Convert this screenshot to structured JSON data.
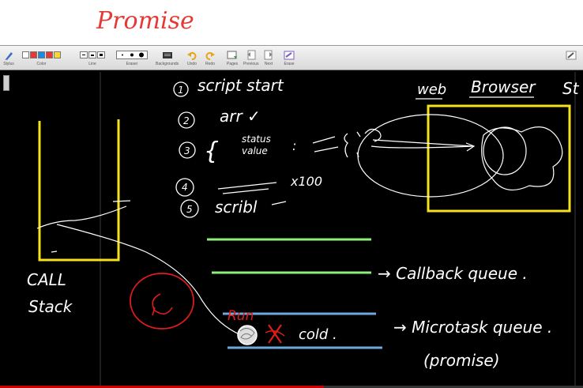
{
  "title": {
    "text": "Promise"
  },
  "toolbar": {
    "stylus": "Stylus",
    "color": "Color",
    "line": "Line",
    "eraser": "Eraser",
    "backgrounds": "Backgrounds",
    "undo": "Undo",
    "redo": "Redo",
    "pages": "Pages",
    "previous": "Previous",
    "next": "Next",
    "erase": "Erase",
    "swatches": [
      "#ffffff",
      "#e53935",
      "#1e88e5",
      "#e53935",
      "#fdd835"
    ]
  },
  "board": {
    "background": "#000000",
    "steps": [
      {
        "num": "1",
        "text": "script start"
      },
      {
        "num": "2",
        "text": "arr ✓"
      },
      {
        "num": "3",
        "text": "status",
        "text2": "value"
      },
      {
        "num": "4",
        "text": "x100"
      },
      {
        "num": "5",
        "text": "scribl"
      }
    ],
    "web_label": "web",
    "browser_label": "Browser",
    "st_label": "St",
    "call_label": "CALL",
    "stack_label": "Stack",
    "callback_label": "→ Callback queue .",
    "microtask_label": "→ Microtask queue .",
    "promise_label": "(promise)",
    "run_label": "Run",
    "cold_label": "cold .",
    "colors": {
      "yellow": "#f5e21b",
      "green": "#8cf07a",
      "blue": "#6fa8dc",
      "red": "#e21b1b",
      "white": "#ffffff"
    }
  }
}
